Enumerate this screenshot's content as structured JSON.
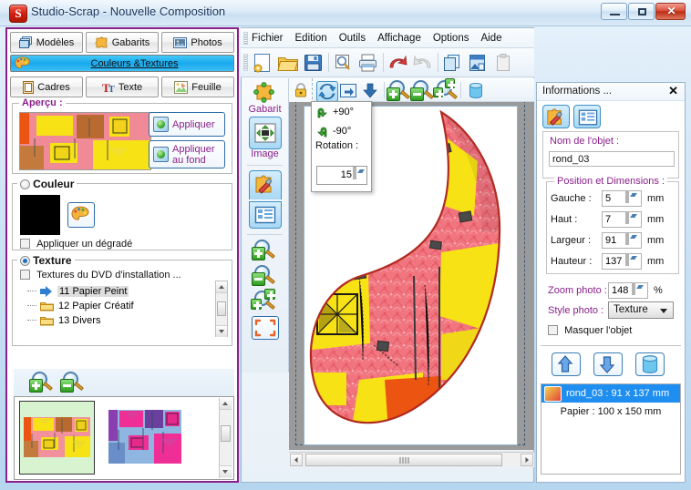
{
  "window": {
    "title": "Studio-Scrap - Nouvelle Composition",
    "app_icon": "studio-scrap-icon",
    "minimize": "minimize-icon",
    "maximize": "maximize-icon",
    "close": "close-icon"
  },
  "left_panel": {
    "tabs_row1": [
      {
        "label": "Modèles",
        "icon": "layers-icon"
      },
      {
        "label": "Gabarits",
        "icon": "puzzle-icon"
      },
      {
        "label": "Photos",
        "icon": "photo-icon"
      }
    ],
    "active_tab": {
      "label": "Couleurs &Textures",
      "icon": "palette-icon"
    },
    "tabs_row2": [
      {
        "label": "Cadres",
        "icon": "frame-icon"
      },
      {
        "label": "Texte",
        "icon": "text-icon"
      },
      {
        "label": "Feuille",
        "icon": "sheet-icon"
      }
    ],
    "apercu": {
      "title": "Aperçu :",
      "apply_label": "Appliquer",
      "apply_bg_label_line1": "Appliquer",
      "apply_bg_label_line2": "au fond"
    },
    "couleur": {
      "title": "Couleur",
      "selected": false,
      "swatch_color": "#000000",
      "palette_icon": "palette-icon",
      "gradient_label": "Appliquer un dégradé",
      "gradient_checked": false
    },
    "texture": {
      "title": "Texture",
      "selected": true,
      "dvd_label": "Textures du DVD d'installation ...",
      "dvd_checked": false,
      "tree": [
        {
          "label": "11 Papier Peint",
          "icon": "blue-arrow-icon",
          "selected": true
        },
        {
          "label": "12 Papier Créatif",
          "icon": "folder-icon",
          "selected": false
        },
        {
          "label": "13 Divers",
          "icon": "folder-icon",
          "selected": false
        }
      ]
    },
    "zoom_tools": [
      {
        "name": "zoom-in-icon"
      },
      {
        "name": "zoom-out-icon"
      }
    ],
    "thumbnails": [
      {
        "name": "texture-thumb-warm",
        "selected": true
      },
      {
        "name": "texture-thumb-cool",
        "selected": false
      }
    ]
  },
  "menu": {
    "items": [
      "Fichier",
      "Edition",
      "Outils",
      "Affichage",
      "Options",
      "Aide"
    ]
  },
  "main_toolbar": [
    {
      "name": "new-document-icon"
    },
    {
      "name": "open-folder-icon"
    },
    {
      "name": "save-icon"
    },
    {
      "name": "print-preview-icon"
    },
    {
      "name": "print-icon"
    },
    {
      "name": "undo-icon"
    },
    {
      "name": "redo-icon"
    },
    {
      "name": "copy-icon"
    },
    {
      "name": "paste-page-icon"
    },
    {
      "name": "clipboard-icon"
    }
  ],
  "tool_column": {
    "gabarit_label": "Gabarit",
    "gabarit_icon": "puzzle-icon",
    "image_label": "Image",
    "image_icon": "move-image-icon",
    "image_selected": true,
    "tools": [
      {
        "name": "properties-tool-icon",
        "selected": true
      },
      {
        "name": "list-tool-icon",
        "selected": true
      },
      {
        "name": "zoom-in-icon",
        "selected": false
      },
      {
        "name": "zoom-out-icon",
        "selected": false
      },
      {
        "name": "zoom-fit-icon",
        "selected": false
      },
      {
        "name": "fullscreen-icon",
        "selected": false
      }
    ]
  },
  "icon_column": [
    {
      "name": "lock-icon",
      "selected": false
    },
    {
      "name": "move-icon",
      "selected": false
    },
    {
      "name": "move-image-icon",
      "selected": true
    },
    {
      "name": "grayscale-icon",
      "selected": false
    },
    {
      "name": "sepia-icon",
      "selected": false
    },
    {
      "name": "green-filter-icon",
      "selected": false
    },
    {
      "name": "brightness-icon",
      "selected": false
    },
    {
      "name": "contrast-icon",
      "selected": false
    },
    {
      "name": "silhouette-icon",
      "selected": false
    },
    {
      "name": "flip-icon",
      "selected": false
    }
  ],
  "canvas_toolbar": [
    {
      "name": "rotate-icon",
      "selected": true
    },
    {
      "name": "flip-horizontal-icon",
      "selected": false
    },
    {
      "name": "flip-vertical-icon",
      "selected": false
    },
    {
      "name": "zoom-in-icon",
      "selected": false
    },
    {
      "name": "zoom-out-icon",
      "selected": false
    },
    {
      "name": "zoom-fit-icon",
      "selected": false
    },
    {
      "name": "delete-icon",
      "selected": false
    }
  ],
  "rotation_popup": {
    "plus90_label": "+90°",
    "minus90_label": "-90°",
    "rotation_label": "Rotation :",
    "rotation_value": "15",
    "plus90_icon": "rotate-cw-icon",
    "minus90_icon": "rotate-ccw-icon"
  },
  "right_panel": {
    "title": "Informations ...",
    "close": "close-icon",
    "tab_icons": [
      {
        "name": "properties-tool-icon"
      },
      {
        "name": "list-tool-icon"
      }
    ],
    "object_name": {
      "label": "Nom de l'objet :",
      "value": "rond_03"
    },
    "position_group": {
      "title": "Position et Dimensions :",
      "rows": [
        {
          "label": "Gauche :",
          "value": "5",
          "unit": "mm"
        },
        {
          "label": "Haut :",
          "value": "7",
          "unit": "mm"
        },
        {
          "label": "Largeur :",
          "value": "91",
          "unit": "mm"
        },
        {
          "label": "Hauteur :",
          "value": "137",
          "unit": "mm"
        }
      ]
    },
    "zoom_photo": {
      "label": "Zoom photo :",
      "value": "148",
      "unit": "%"
    },
    "style_photo": {
      "label": "Style photo :",
      "value": "Texture"
    },
    "masquer": {
      "label": "Masquer l'objet",
      "checked": false
    },
    "order_buttons": [
      {
        "name": "move-up-icon"
      },
      {
        "name": "move-down-icon"
      },
      {
        "name": "delete-icon"
      }
    ],
    "object_list": {
      "selected_item": "rond_03 : 91 x 137 mm",
      "paper_item": "Papier : 100 x 150 mm"
    }
  },
  "scrollbars": {
    "horizontal_left_arrow": "scroll-left-icon",
    "horizontal_right_arrow": "scroll-right-icon",
    "vertical_up_arrow": "scroll-up-icon",
    "vertical_down_arrow": "scroll-down-icon"
  },
  "colors": {
    "panel_border": "#8a1f8a",
    "label_purple": "#8a1f8a",
    "highlight_blue": "#1f8ef1",
    "selected_tab": "#19a9ee",
    "canvas_bg": "#9a9a9a",
    "artwork_red": "#e8505a",
    "artwork_yellow": "#f7e215",
    "artwork_orange": "#ec5412"
  }
}
